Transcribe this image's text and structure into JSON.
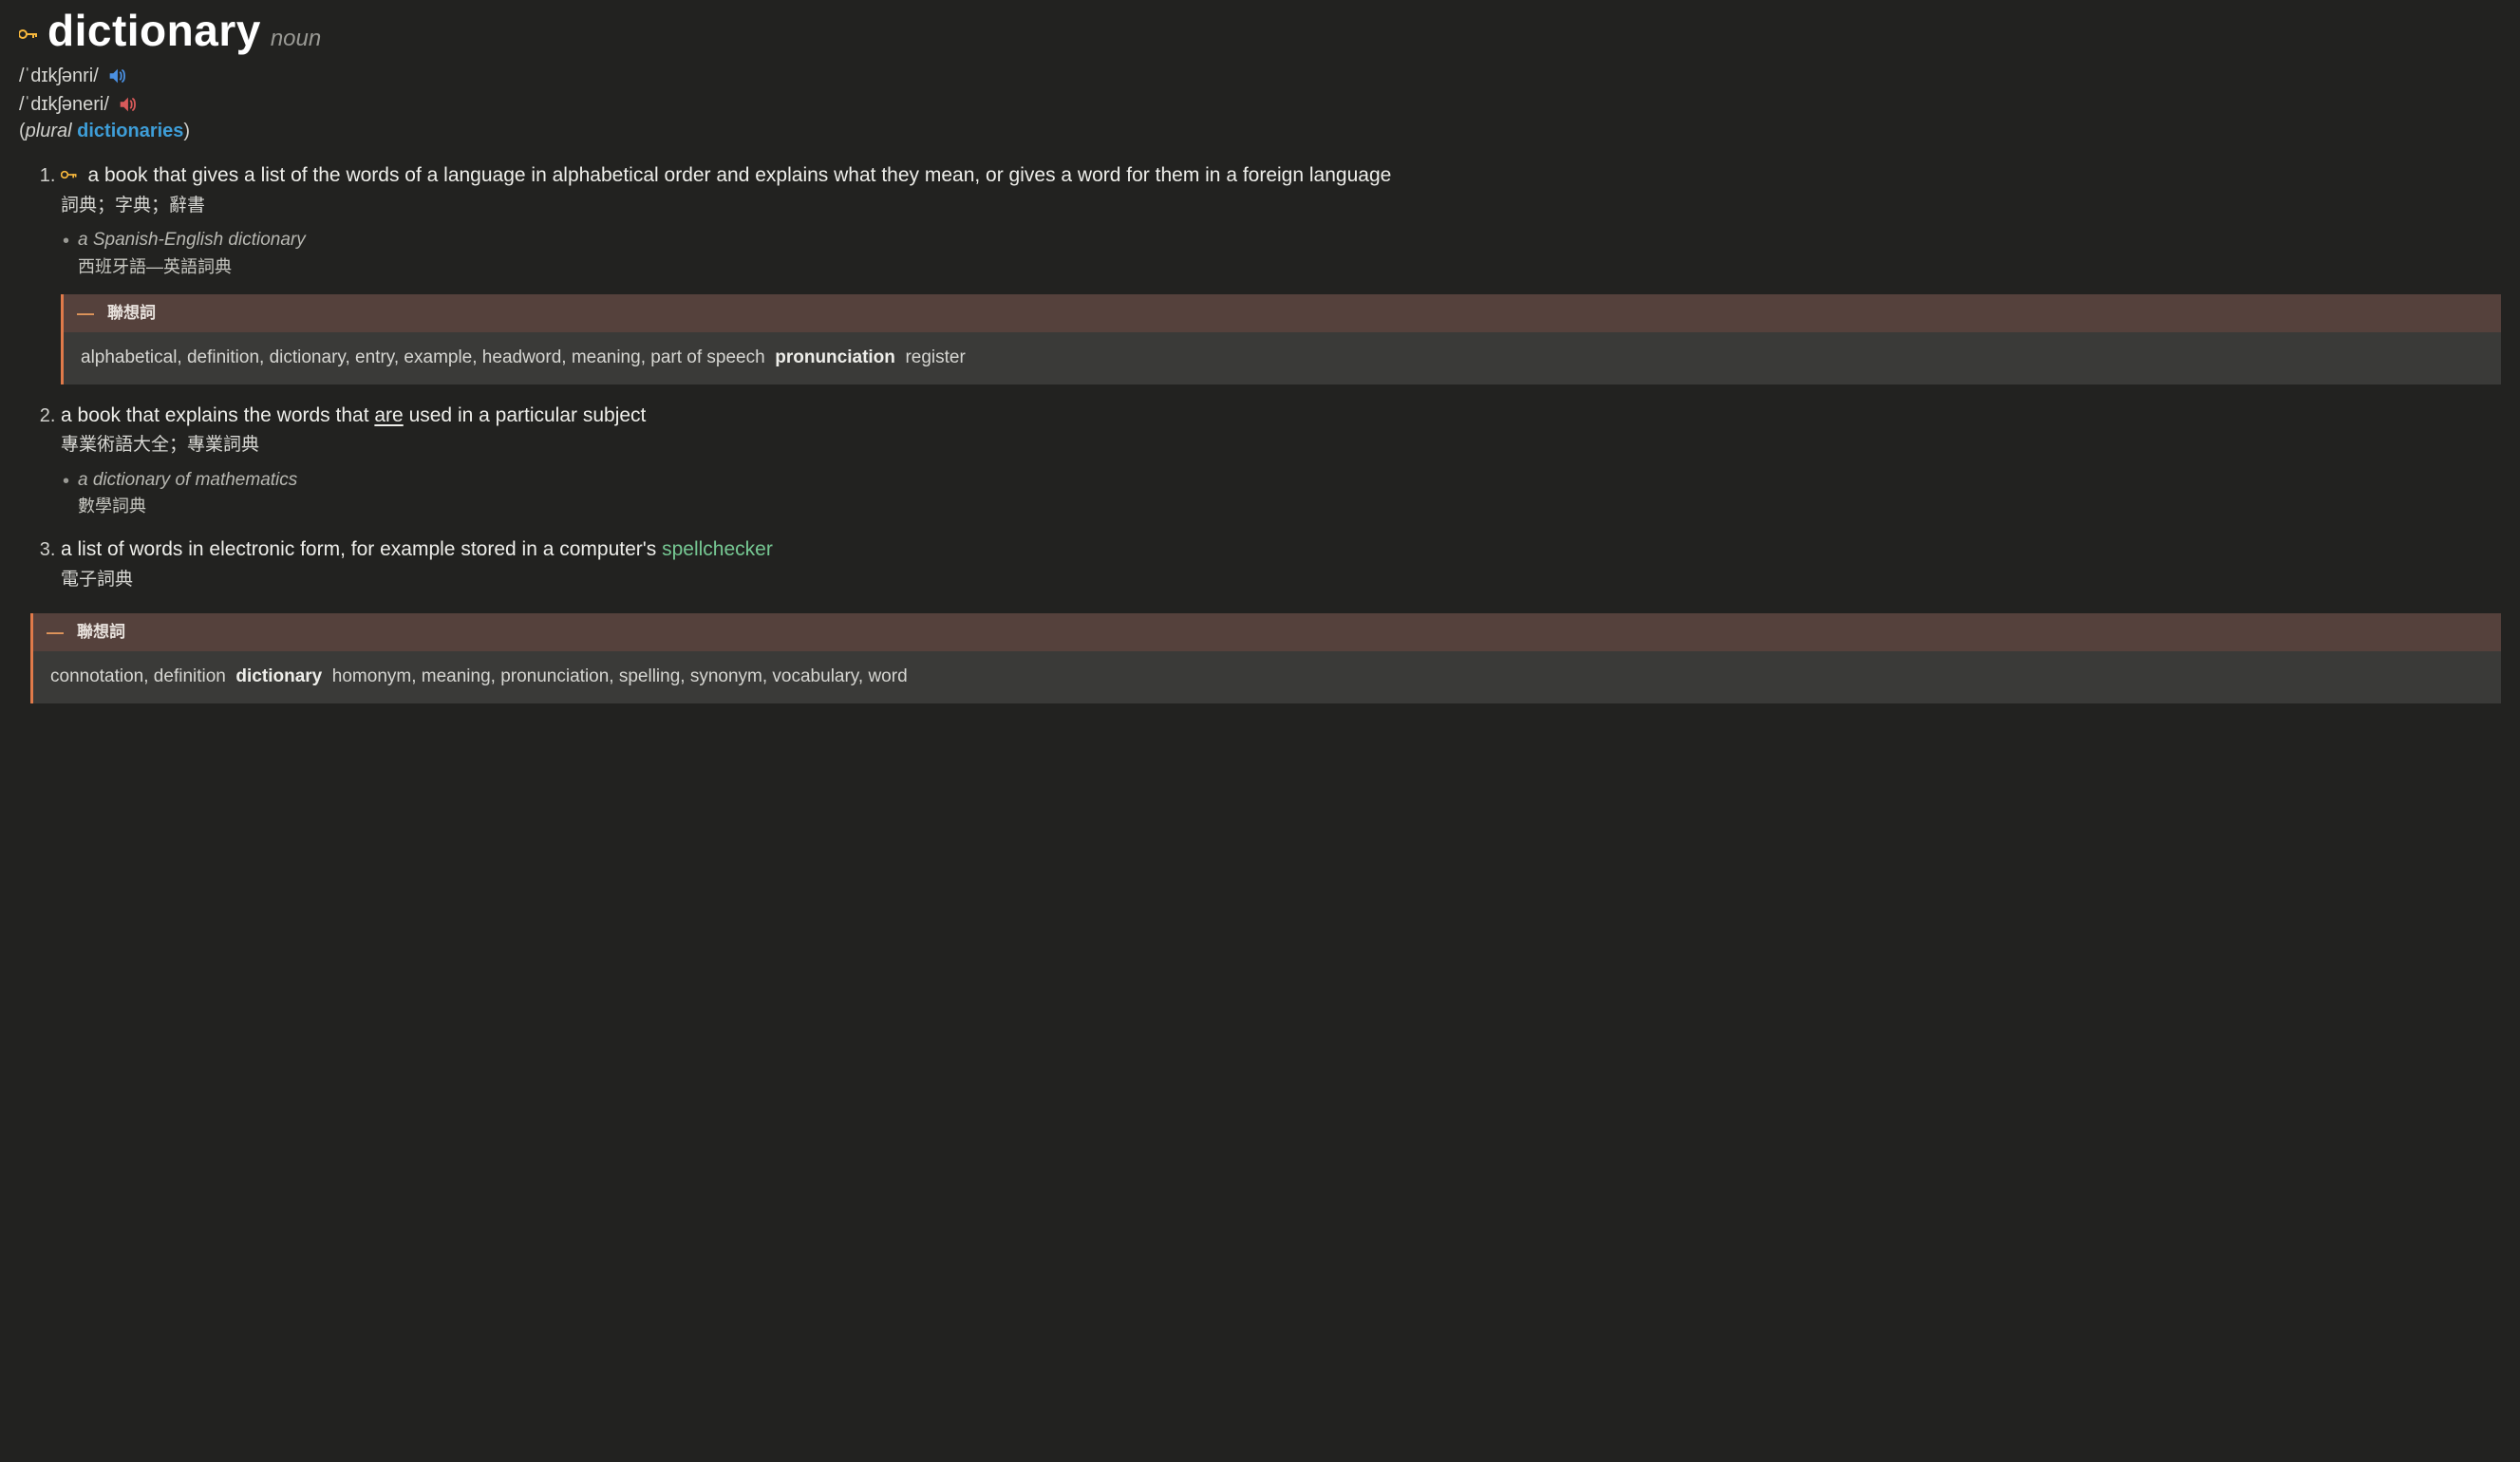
{
  "entry": {
    "headword": "dictionary",
    "pos": "noun",
    "pron_gb": "/ˈdɪkʃənri/",
    "pron_us": "/ˈdɪkʃəneri/",
    "plural": {
      "open": "(",
      "label": "plural",
      "link": "dictionaries",
      "close": ")"
    }
  },
  "senses": [
    {
      "key": true,
      "def_en": "a book that gives a list of the words of a language in alphabetical order and explains what they mean, or gives a word for them in a foreign language",
      "def_zh": "詞典；字典；辭書",
      "examples": [
        {
          "en": "a Spanish-English dictionary",
          "zh": "西班牙語—英語詞典"
        }
      ],
      "collocations": {
        "title": "聯想詞",
        "items": [
          {
            "text": "alphabetical",
            "bold": false
          },
          {
            "text": "definition",
            "bold": false
          },
          {
            "text": "dictionary",
            "bold": false
          },
          {
            "text": "entry",
            "bold": false
          },
          {
            "text": "example",
            "bold": false
          },
          {
            "text": "headword",
            "bold": false
          },
          {
            "text": "meaning",
            "bold": false
          },
          {
            "text": "part of speech",
            "bold": false
          },
          {
            "text": "pronunciation",
            "bold": true
          },
          {
            "text": "register",
            "bold": false
          }
        ]
      }
    },
    {
      "key": false,
      "def_en_pre": "a book that explains the words that ",
      "def_en_underlined": "are",
      "def_en_post": " used in a particular subject",
      "def_zh": "專業術語大全；專業詞典",
      "examples": [
        {
          "en": "a dictionary of mathematics",
          "zh": "數學詞典"
        }
      ]
    },
    {
      "key": false,
      "def_en_pre": "a list of words in electronic form, for example stored in a computer's ",
      "def_en_xref": "spellchecker",
      "def_zh": "電子詞典"
    }
  ],
  "bottom_collocations": {
    "title": "聯想詞",
    "items": [
      {
        "text": "connotation",
        "bold": false
      },
      {
        "text": "definition",
        "bold": false
      },
      {
        "text": "dictionary",
        "bold": true
      },
      {
        "text": "homonym",
        "bold": false
      },
      {
        "text": "meaning",
        "bold": false
      },
      {
        "text": "pronunciation",
        "bold": false
      },
      {
        "text": "spelling",
        "bold": false
      },
      {
        "text": "synonym",
        "bold": false
      },
      {
        "text": "vocabulary",
        "bold": false
      },
      {
        "text": "word",
        "bold": false
      }
    ]
  }
}
